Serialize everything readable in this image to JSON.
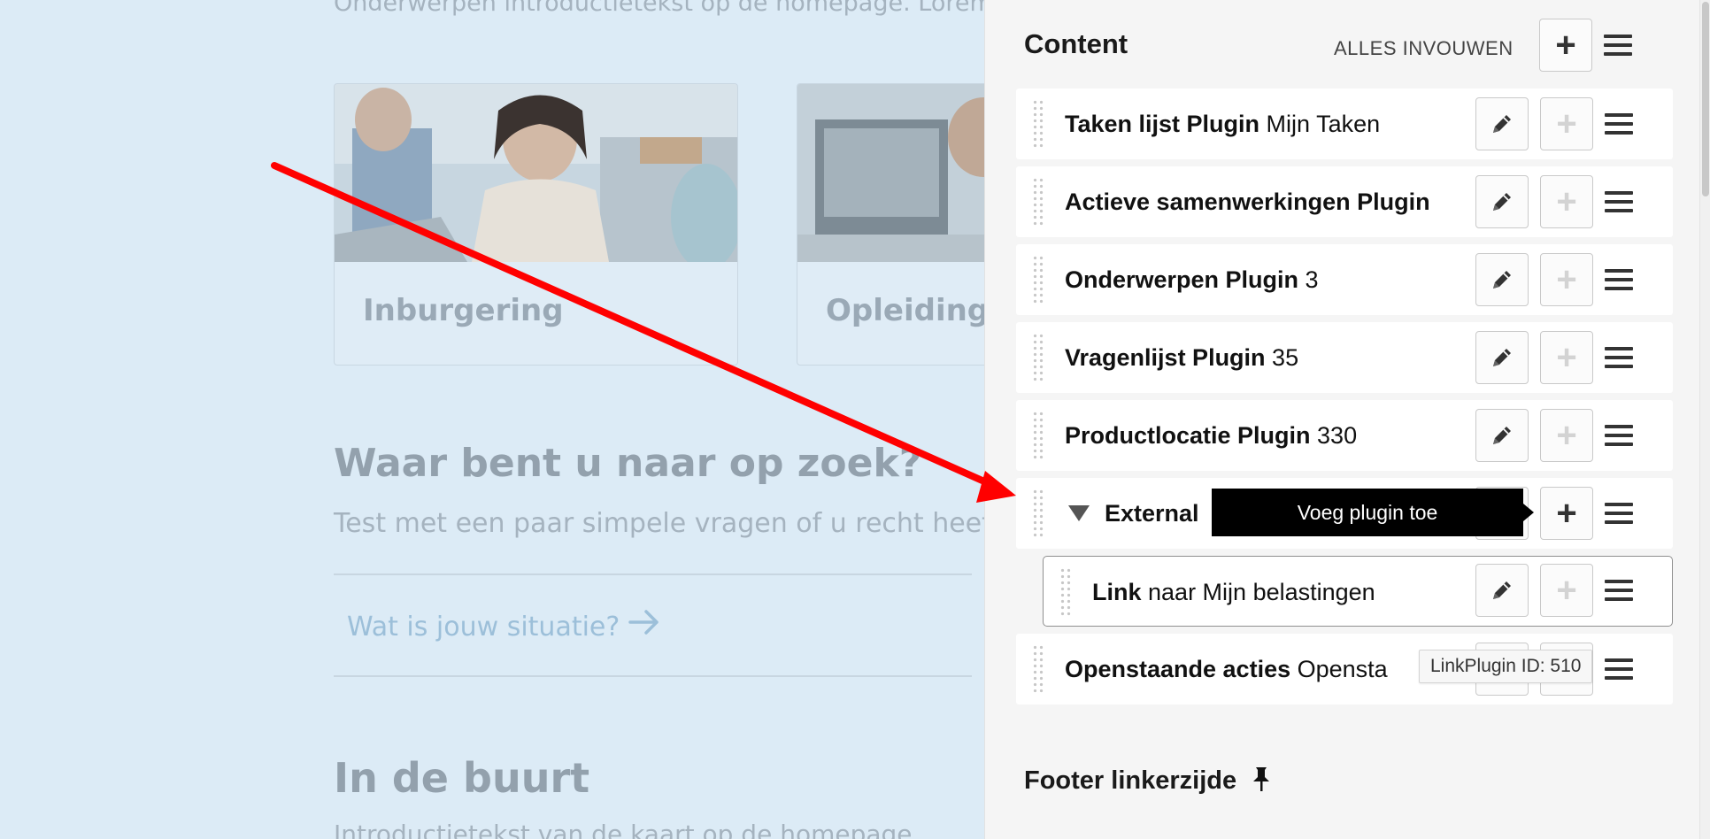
{
  "page": {
    "intro_text": "Onderwerpen introductietekst op de homepage. Lorem",
    "cards": [
      {
        "title": "Inburgering"
      },
      {
        "title": "Opleiding"
      }
    ],
    "search_heading": "Waar bent u naar op zoek?",
    "search_subtext": "Test met een paar simpele vragen of u recht heeft op",
    "situation_link": "Wat is jouw situatie?",
    "near_heading": "In de buurt",
    "near_subtext": "Introductietekst van de kaart op de homepage"
  },
  "panel": {
    "content_title": "Content",
    "collapse_all_label": "ALLES INVOUWEN",
    "add_label": "+",
    "plugins": [
      {
        "bold": "Taken lijst Plugin",
        "rest": " Mijn Taken"
      },
      {
        "bold": "Actieve samenwerkingen Plugin",
        "rest": ""
      },
      {
        "bold": "Onderwerpen Plugin",
        "rest": " 3"
      },
      {
        "bold": "Vragenlijst Plugin",
        "rest": " 35"
      },
      {
        "bold": "Productlocatie Plugin",
        "rest": " 330"
      }
    ],
    "external": {
      "label": "External"
    },
    "child_plugin": {
      "bold": "Link",
      "rest": " naar Mijn belastingen"
    },
    "last_plugin": {
      "bold": "Openstaande acties",
      "rest": " Opensta"
    },
    "tooltip_add_plugin": "Voeg plugin toe",
    "tooltip_plugin_id": "LinkPlugin ID: 510",
    "footer_title": "Footer linkerzijde",
    "icons": {
      "edit": "pencil-icon",
      "add": "plus-icon",
      "menu": "hamburger-icon",
      "collapse": "triangle-down-icon",
      "pin": "pushpin-icon",
      "drag": "drag-handle-icon"
    }
  },
  "annotation": {
    "arrow_color": "#ff0000"
  }
}
